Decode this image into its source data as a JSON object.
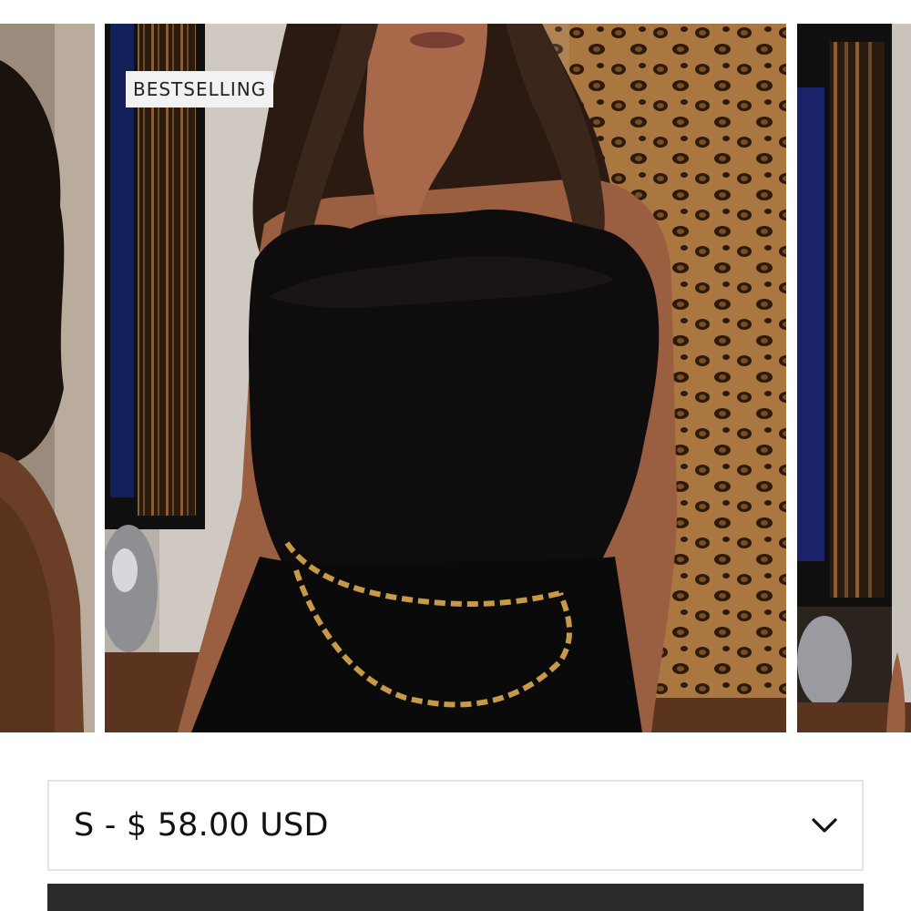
{
  "badge": {
    "label": "BESTSELLING"
  },
  "carousel": {
    "slides": [
      {
        "name": "previous-product-photo"
      },
      {
        "name": "main-product-photo"
      },
      {
        "name": "next-product-photo"
      }
    ]
  },
  "variant_select": {
    "selected_label": "S - $ 58.00 USD",
    "icon": "chevron-down-icon"
  },
  "colors": {
    "accent_dark": "#2a2a2a",
    "border": "#e3e3e3",
    "badge_bg": "#f2f2f2"
  }
}
